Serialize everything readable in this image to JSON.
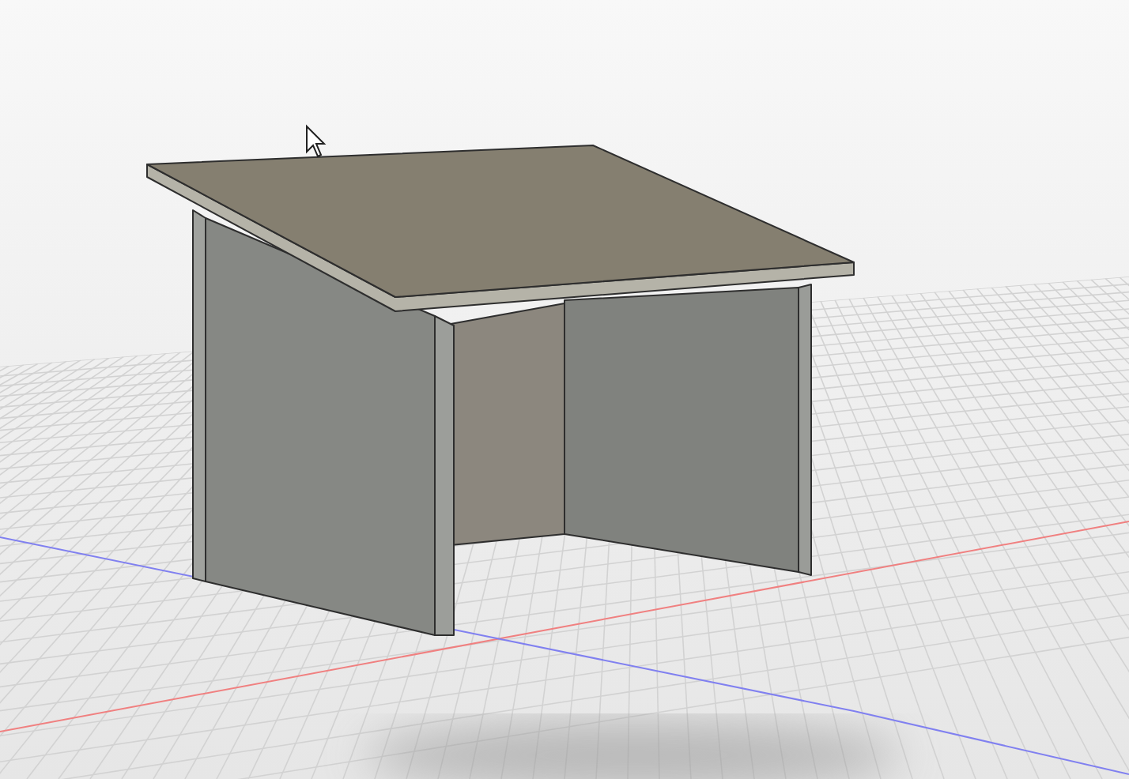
{
  "viewport": {
    "grid_visible": true,
    "cursor_visible": true
  }
}
